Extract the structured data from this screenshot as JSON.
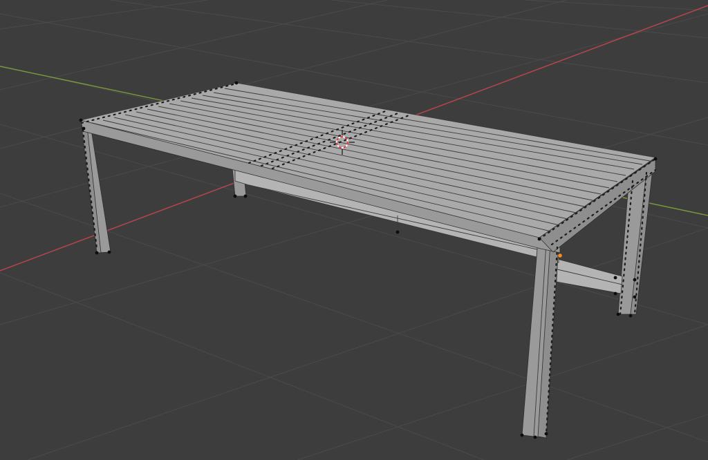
{
  "viewport": {
    "background": "#3d3d3d",
    "grid_color": "#4a4a4a",
    "x_axis_color": "#c0454f",
    "y_axis_color": "#7a9a3c",
    "mesh_color": "#a9a9a9",
    "vertex_color": "#0d0d0d",
    "active_vertex_color": "#ff8c1a",
    "cursor_color": "#e8383d"
  },
  "scene": {
    "object": "table-mesh",
    "mode_hint": "edit-mode",
    "top_slat_count": 14
  },
  "icons": {
    "cursor": "3d-cursor-icon"
  }
}
